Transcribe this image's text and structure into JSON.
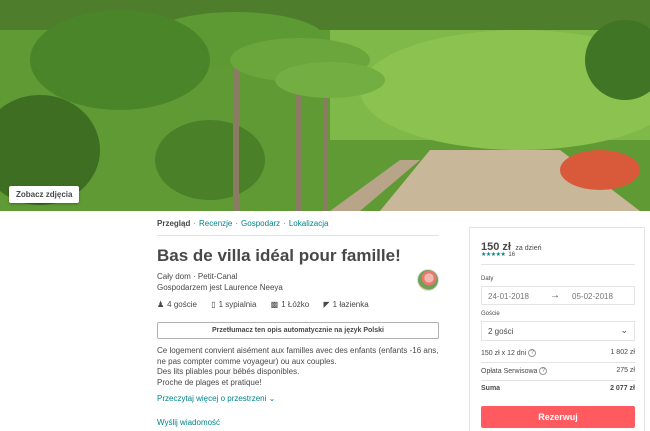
{
  "hero": {
    "photo_button": "Zobacz zdjęcia"
  },
  "subnav": {
    "items": [
      {
        "label": "Przegląd"
      },
      {
        "label": "Recenzje"
      },
      {
        "label": "Gospodarz"
      },
      {
        "label": "Lokalizacja"
      }
    ],
    "separator": "·"
  },
  "listing": {
    "title": "Bas de villa idéal pour famille!",
    "type_location": "Cały dom · Petit-Canal",
    "host_line": "Gospodarzem jest Laurence Neeya",
    "amenities": [
      {
        "icon": "guests-icon",
        "label": "4 goście"
      },
      {
        "icon": "bedroom-icon",
        "label": "1 sypialnia"
      },
      {
        "icon": "bed-icon",
        "label": "1 Łóżko"
      },
      {
        "icon": "bath-icon",
        "label": "1 łazienka"
      }
    ],
    "translate_button": "Przetłumacz ten opis automatycznie na język Polski",
    "description": [
      "Ce logement convient aisément aux familles avec des enfants (enfants -16 ans,",
      "ne pas compter comme voyageur) ou aux couples.",
      "Des lits pliables pour bébés disponibles.",
      "Proche de plages et pratique!"
    ],
    "read_more": "Przeczytaj więcej o przestrzeni",
    "message_link": "Wyślij wiadomość"
  },
  "booking": {
    "price": "150 zł",
    "per": "za dzień",
    "rating_stars": "★★★★★",
    "review_count": "16",
    "dates_label": "Daty",
    "checkin": "24-01-2018",
    "arrow": "→",
    "checkout": "05-02-2018",
    "guests_label": "Goście",
    "guests_value": "2 gości",
    "line1_label": "150 zł x 12 dni",
    "line1_value": "1 802 zł",
    "line2_label": "Opłata Serwisowa",
    "line2_value": "275 zł",
    "total_label": "Suma",
    "total_value": "2 077 zł",
    "reserve_button": "Rezerwuj"
  },
  "colors": {
    "accent": "#008489",
    "brand": "#ff5a5f",
    "text": "#484848"
  }
}
